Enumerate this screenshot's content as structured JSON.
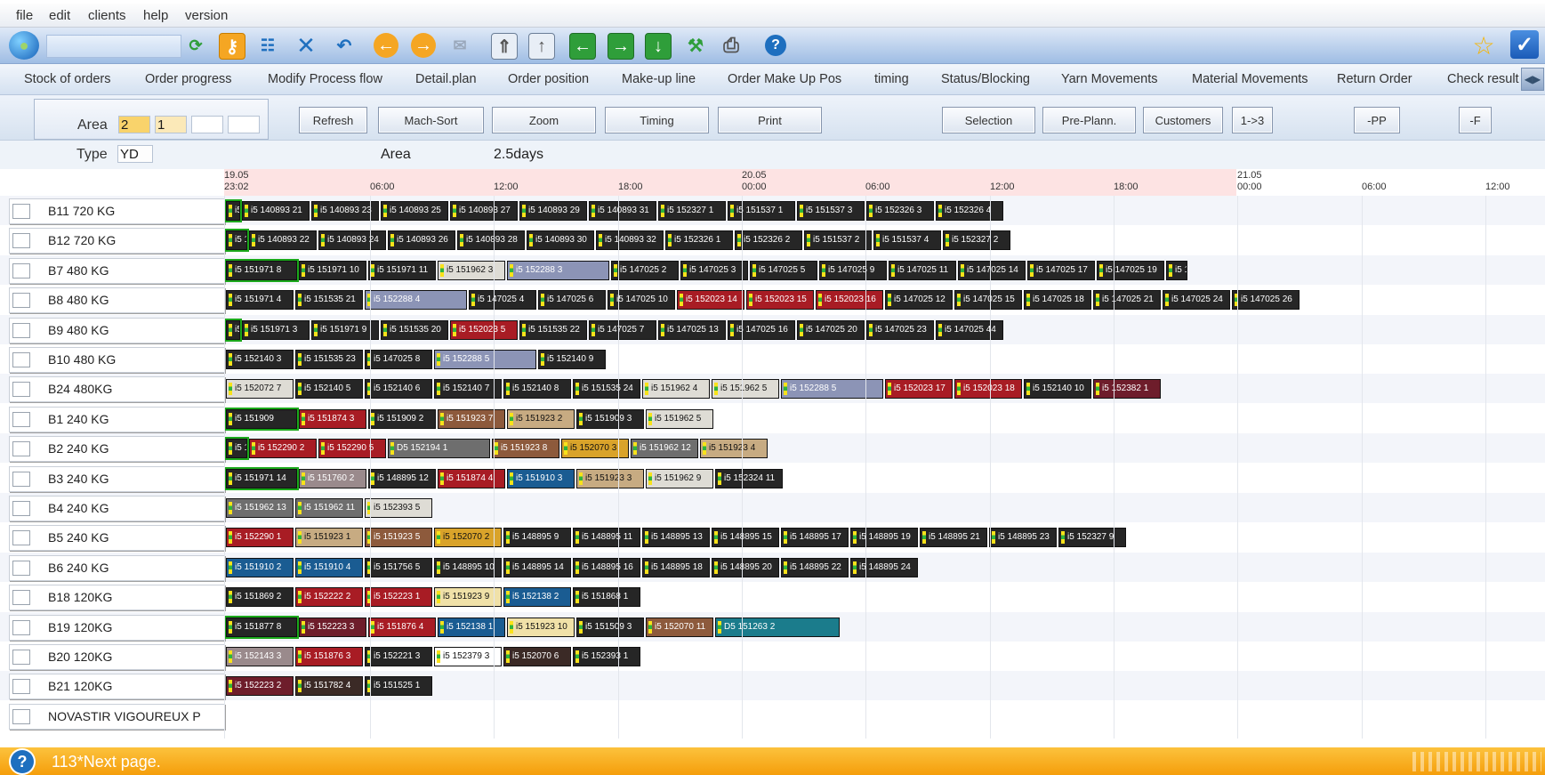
{
  "menu": [
    "file",
    "edit",
    "clients",
    "help",
    "version"
  ],
  "tabs": [
    "Stock of orders",
    "Order progress",
    "Modify Process flow",
    "Detail.plan",
    "Order position",
    "Make-up line",
    "Order Make Up Pos",
    "timing",
    "Status/Blocking",
    "Yarn Movements",
    "Material Movements",
    "Return Order",
    "Check result"
  ],
  "controls": {
    "area_label": "Area",
    "area_values": [
      "2",
      "1",
      "",
      ""
    ],
    "type_label": "Type",
    "type_value": "YD",
    "area_info_label": "Area",
    "area_info_value": "2.5days",
    "buttons": [
      "Refresh",
      "Mach-Sort",
      "Zoom",
      "Timing",
      "Print",
      "Selection",
      "Pre-Plann.",
      "Customers",
      "1->3",
      "-PP",
      "-F"
    ]
  },
  "timeline": {
    "ticks": [
      {
        "top": "19.05",
        "bottom": "23:02"
      },
      {
        "top": "",
        "bottom": "06:00"
      },
      {
        "top": "",
        "bottom": "12:00"
      },
      {
        "top": "",
        "bottom": "18:00"
      },
      {
        "top": "20.05",
        "bottom": "00:00"
      },
      {
        "top": "",
        "bottom": "06:00"
      },
      {
        "top": "",
        "bottom": "12:00"
      },
      {
        "top": "",
        "bottom": "18:00"
      },
      {
        "top": "21.05",
        "bottom": "00:00"
      },
      {
        "top": "",
        "bottom": "06:00"
      },
      {
        "top": "",
        "bottom": "12:00"
      }
    ]
  },
  "colors": {
    "dark": "#262626",
    "red": "#a81c24",
    "maroon": "#6e1d2b",
    "slate": "#8c94b6",
    "brown": "#8d5a3c",
    "tan": "#c7ab82",
    "light": "#dedcd5",
    "gray": "#6e6e6e",
    "blue": "#1a5c92",
    "teal": "#1b7c8c",
    "gold": "#d9a32a",
    "cream": "#f0e1a8",
    "white": "#ffffff",
    "mauve": "#9a8a8c",
    "darkbrown": "#3b2a26"
  },
  "rows": [
    {
      "label": "B11 720 KG",
      "bars": [
        [
          "i5",
          "dark",
          1
        ],
        [
          "i5 140893 21",
          "dark",
          0
        ],
        [
          "i5 140893 23",
          "dark",
          0
        ],
        [
          "i5 140893 25",
          "dark",
          0
        ],
        [
          "i5 140893 27",
          "dark",
          0
        ],
        [
          "i5 140893 29",
          "dark",
          0
        ],
        [
          "i5 140893 31",
          "dark",
          0
        ],
        [
          "i5 152327 1",
          "dark",
          0
        ],
        [
          "i5 151537 1",
          "dark",
          0
        ],
        [
          "i5 151537 3",
          "dark",
          0
        ],
        [
          "i5 152326 3",
          "dark",
          0
        ],
        [
          "i5 152326 4",
          "dark",
          0
        ]
      ]
    },
    {
      "label": "B12 720 KG",
      "bars": [
        [
          "i5 14",
          "dark",
          1
        ],
        [
          "i5 140893 22",
          "dark",
          0
        ],
        [
          "i5 140893 24",
          "dark",
          0
        ],
        [
          "i5 140893 26",
          "dark",
          0
        ],
        [
          "i5 140893 28",
          "dark",
          0
        ],
        [
          "i5 140893 30",
          "dark",
          0
        ],
        [
          "i5 140893 32",
          "dark",
          0
        ],
        [
          "i5 152326 1",
          "dark",
          0
        ],
        [
          "i5 152326 2",
          "dark",
          0
        ],
        [
          "i5 151537 2",
          "dark",
          0
        ],
        [
          "i5 151537 4",
          "dark",
          0
        ],
        [
          "i5 152327 2",
          "dark",
          0
        ]
      ]
    },
    {
      "label": "B7 480 KG",
      "bars": [
        [
          "i5 151971 8",
          "dark",
          1
        ],
        [
          "i5 151971 10",
          "dark",
          0
        ],
        [
          "i5 151971 11",
          "dark",
          0
        ],
        [
          "i5 151962 3",
          "light",
          0
        ],
        [
          "i5 152288 3",
          "slate",
          0
        ],
        [
          "i5 147025 2",
          "dark",
          0
        ],
        [
          "i5 147025 3",
          "dark",
          0
        ],
        [
          "i5 147025 5",
          "dark",
          0
        ],
        [
          "i5 147025 9",
          "dark",
          0
        ],
        [
          "i5 147025 11",
          "dark",
          0
        ],
        [
          "i5 147025 14",
          "dark",
          0
        ],
        [
          "i5 147025 17",
          "dark",
          0
        ],
        [
          "i5 147025 19",
          "dark",
          0
        ],
        [
          "i5 1",
          "dark",
          0
        ]
      ]
    },
    {
      "label": "B8 480 KG",
      "bars": [
        [
          "i5 151971 4",
          "dark",
          0
        ],
        [
          "i5 151535 21",
          "dark",
          0
        ],
        [
          "i5 152288 4",
          "slate",
          0
        ],
        [
          "i5 147025 4",
          "dark",
          0
        ],
        [
          "i5 147025 6",
          "dark",
          0
        ],
        [
          "i5 147025 10",
          "dark",
          0
        ],
        [
          "i5 152023 14",
          "red",
          0
        ],
        [
          "i5 152023 15",
          "red",
          0
        ],
        [
          "i5 152023 16",
          "red",
          0
        ],
        [
          "i5 147025 12",
          "dark",
          0
        ],
        [
          "i5 147025 15",
          "dark",
          0
        ],
        [
          "i5 147025 18",
          "dark",
          0
        ],
        [
          "i5 147025 21",
          "dark",
          0
        ],
        [
          "i5 147025 24",
          "dark",
          0
        ],
        [
          "i5 147025 26",
          "dark",
          0
        ]
      ]
    },
    {
      "label": "B9 480 KG",
      "bars": [
        [
          "i5",
          "dark",
          1
        ],
        [
          "i5 151971 3",
          "dark",
          0
        ],
        [
          "i5 151971 9",
          "dark",
          0
        ],
        [
          "i5 151535 20",
          "dark",
          0
        ],
        [
          "i5 152023 5",
          "red",
          0
        ],
        [
          "i5 151535 22",
          "dark",
          0
        ],
        [
          "i5 147025 7",
          "dark",
          0
        ],
        [
          "i5 147025 13",
          "dark",
          0
        ],
        [
          "i5 147025 16",
          "dark",
          0
        ],
        [
          "i5 147025 20",
          "dark",
          0
        ],
        [
          "i5 147025 23",
          "dark",
          0
        ],
        [
          "i5 147025 44",
          "dark",
          0
        ]
      ]
    },
    {
      "label": "B10 480 KG",
      "bars": [
        [
          "i5 152140 3",
          "dark",
          0
        ],
        [
          "i5 151535 23",
          "dark",
          0
        ],
        [
          "i5 147025 8",
          "dark",
          0
        ],
        [
          "i5 152288 5",
          "slate",
          0
        ],
        [
          "i5 152140 9",
          "dark",
          0
        ]
      ]
    },
    {
      "label": "B24 480KG",
      "bars": [
        [
          "i5 152072 7",
          "light",
          0
        ],
        [
          "i5 152140 5",
          "dark",
          0
        ],
        [
          "i5 152140 6",
          "dark",
          0
        ],
        [
          "i5 152140 7",
          "dark",
          0
        ],
        [
          "i5 152140 8",
          "dark",
          0
        ],
        [
          "i5 151535 24",
          "dark",
          0
        ],
        [
          "i5 151962 4",
          "light",
          0
        ],
        [
          "i5 151962 5",
          "light",
          0
        ],
        [
          "i5 152288 5",
          "slate",
          0
        ],
        [
          "i5 152023 17",
          "red",
          0
        ],
        [
          "i5 152023 18",
          "red",
          0
        ],
        [
          "i5 152140 10",
          "dark",
          0
        ],
        [
          "i5 152382 1",
          "maroon",
          0
        ]
      ]
    },
    {
      "label": "B1 240 KG",
      "bars": [
        [
          "i5 151909",
          "dark",
          1
        ],
        [
          "i5 151874 3",
          "red",
          0
        ],
        [
          "i5 151909 2",
          "dark",
          0
        ],
        [
          "i5 151923 7",
          "brown",
          0
        ],
        [
          "i5 151923 2",
          "tan",
          0
        ],
        [
          "i5 151909 3",
          "dark",
          0
        ],
        [
          "i5 151962 5",
          "light",
          0
        ]
      ]
    },
    {
      "label": "B2 240 KG",
      "bars": [
        [
          "i5 1",
          "dark",
          1
        ],
        [
          "i5 152290 2",
          "red",
          0
        ],
        [
          "i5 152290 5",
          "red",
          0
        ],
        [
          "D5 152194 1",
          "gray",
          0
        ],
        [
          "i5 151923 8",
          "brown",
          0
        ],
        [
          "i5 152070 3",
          "gold",
          0
        ],
        [
          "i5 151962 12",
          "gray",
          0
        ],
        [
          "i5 151923 4",
          "tan",
          0
        ]
      ]
    },
    {
      "label": "B3 240 KG",
      "bars": [
        [
          "i5 151971 14",
          "dark",
          1
        ],
        [
          "i5 151760 2",
          "mauve",
          0
        ],
        [
          "i5 148895 12",
          "dark",
          0
        ],
        [
          "i5 151874 4",
          "red",
          0
        ],
        [
          "i5 151910 3",
          "blue",
          0
        ],
        [
          "i5 151923 3",
          "tan",
          0
        ],
        [
          "i5 151962 9",
          "light",
          0
        ],
        [
          "i5 152324 11",
          "dark",
          0
        ]
      ]
    },
    {
      "label": "B4 240 KG",
      "bars": [
        [
          "i5 151962 13",
          "gray",
          0
        ],
        [
          "i5 151962 11",
          "gray",
          0
        ],
        [
          "i5 152393 5",
          "light",
          0
        ]
      ]
    },
    {
      "label": "B5 240 KG",
      "bars": [
        [
          "i5 152290 1",
          "red",
          0
        ],
        [
          "i5 151923 1",
          "tan",
          0
        ],
        [
          "i5 151923 5",
          "brown",
          0
        ],
        [
          "i5 152070 2",
          "gold",
          0
        ],
        [
          "i5 148895 9",
          "dark",
          0
        ],
        [
          "i5 148895 11",
          "dark",
          0
        ],
        [
          "i5 148895 13",
          "dark",
          0
        ],
        [
          "i5 148895 15",
          "dark",
          0
        ],
        [
          "i5 148895 17",
          "dark",
          0
        ],
        [
          "i5 148895 19",
          "dark",
          0
        ],
        [
          "i5 148895 21",
          "dark",
          0
        ],
        [
          "i5 148895 23",
          "dark",
          0
        ],
        [
          "i5 152327 9",
          "dark",
          0
        ]
      ]
    },
    {
      "label": "B6 240 KG",
      "bars": [
        [
          "i5 151910 2",
          "blue",
          0
        ],
        [
          "i5 151910 4",
          "blue",
          0
        ],
        [
          "i5 151756 5",
          "dark",
          0
        ],
        [
          "i5 148895 10",
          "dark",
          0
        ],
        [
          "i5 148895 14",
          "dark",
          0
        ],
        [
          "i5 148895 16",
          "dark",
          0
        ],
        [
          "i5 148895 18",
          "dark",
          0
        ],
        [
          "i5 148895 20",
          "dark",
          0
        ],
        [
          "i5 148895 22",
          "dark",
          0
        ],
        [
          "i5 148895 24",
          "dark",
          0
        ]
      ]
    },
    {
      "label": "B18 120KG",
      "bars": [
        [
          "i5 151869 2",
          "dark",
          0
        ],
        [
          "i5 152222 2",
          "red",
          0
        ],
        [
          "i5 152223 1",
          "red",
          0
        ],
        [
          "i5 151923 9",
          "cream",
          0
        ],
        [
          "i5 152138 2",
          "blue",
          0
        ],
        [
          "i5 151868 1",
          "dark",
          0
        ]
      ]
    },
    {
      "label": "B19 120KG",
      "bars": [
        [
          "i5 151877 8",
          "dark",
          1
        ],
        [
          "i5 152223 3",
          "maroon",
          0
        ],
        [
          "i5 151876 4",
          "red",
          0
        ],
        [
          "i5 152138 1",
          "blue",
          0
        ],
        [
          "i5 151923 10",
          "cream",
          0
        ],
        [
          "i5 151509 3",
          "dark",
          0
        ],
        [
          "i5 152070 11",
          "brown",
          0
        ],
        [
          "D5 151263 2",
          "teal",
          0
        ]
      ]
    },
    {
      "label": "B20 120KG",
      "bars": [
        [
          "i5 152143 3",
          "mauve",
          0
        ],
        [
          "i5 151876 3",
          "red",
          0
        ],
        [
          "i5 152221 3",
          "dark",
          0
        ],
        [
          "i5 152379 3",
          "white",
          0
        ],
        [
          "i5 152070 6",
          "darkbrown",
          0
        ],
        [
          "i5 152393 1",
          "dark",
          0
        ]
      ]
    },
    {
      "label": "B21 120KG",
      "bars": [
        [
          "i5 152223 2",
          "maroon",
          0
        ],
        [
          "i5 151782 4",
          "darkbrown",
          0
        ],
        [
          "i5 151525 1",
          "dark",
          0
        ]
      ]
    },
    {
      "label": "NOVASTIR VIGOUREUX P",
      "bars": []
    }
  ],
  "status": {
    "text": "113*Next page."
  }
}
